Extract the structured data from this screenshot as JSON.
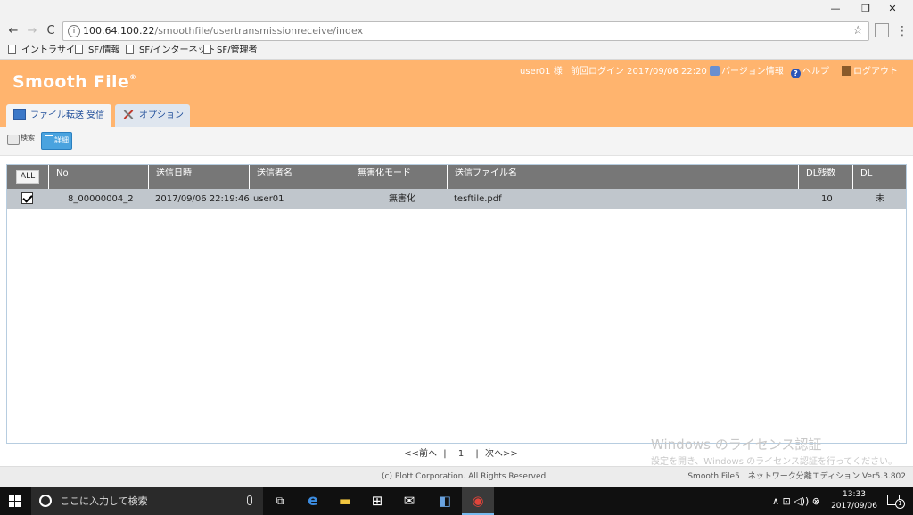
{
  "window": {
    "minimize_glyph": "—",
    "restore_glyph": "❐",
    "close_glyph": "✕"
  },
  "browser": {
    "url_host": "100.64.100.22",
    "url_path": "/smoothfile/usertransmissionreceive/index",
    "back_glyph": "←",
    "forward_glyph": "→",
    "reload_glyph": "C",
    "star_glyph": "☆",
    "menu_glyph": "⋮",
    "bookmarks": [
      "イントラサイト",
      "SF/情報",
      "SF/インターネット",
      "SF/管理者"
    ]
  },
  "app": {
    "logo": "Smooth File",
    "logo_mark": "®",
    "user": "user01 様",
    "last_login": "前回ログイン 2017/09/06 22:20",
    "version_link": "バージョン情報",
    "help_link": "ヘルプ",
    "logout_link": "ログアウト",
    "tabs": [
      {
        "label": "ファイル転送 受信",
        "active": true
      },
      {
        "label": "オプション",
        "active": false
      }
    ],
    "toolbar": {
      "search_label": "検索",
      "detail_label": "詳細"
    }
  },
  "table": {
    "all_button": "ALL",
    "columns": [
      "No",
      "送信日時",
      "送信者名",
      "無害化モード",
      "送信ファイル名",
      "DL残数",
      "DL"
    ],
    "rows": [
      {
        "checked": true,
        "no": "8_00000004_2",
        "sent_at": "2017/09/06 22:19:46",
        "sender": "user01",
        "sanitize_mode": "無害化",
        "file_name": "tesftile.pdf",
        "dl_remaining": "10",
        "dl": "未"
      }
    ]
  },
  "pager": {
    "prev": "<<前へ",
    "sep1": "|",
    "page": "1",
    "sep2": "|",
    "next": "次へ>>"
  },
  "watermark": {
    "line1": "Windows のライセンス認証",
    "line2": "設定を開き、Windows のライセンス認証を行ってください。"
  },
  "footer": {
    "copyright": "(c) Plott Corporation. All Rights Reserved",
    "edition": "Smooth File5　ネットワーク分離エディション Ver5.3.802"
  },
  "taskbar": {
    "search_placeholder": "ここに入力して検索",
    "time": "13:33",
    "date": "2017/09/06",
    "notif_count": "1",
    "tray_glyphs": "∧ ⊡ ◁)) ⊗"
  },
  "colors": {
    "header_orange": "#ffb46e",
    "table_header_gray": "#777777",
    "row_selected": "#c0c6cc",
    "link_blue": "#1f4e9a"
  }
}
